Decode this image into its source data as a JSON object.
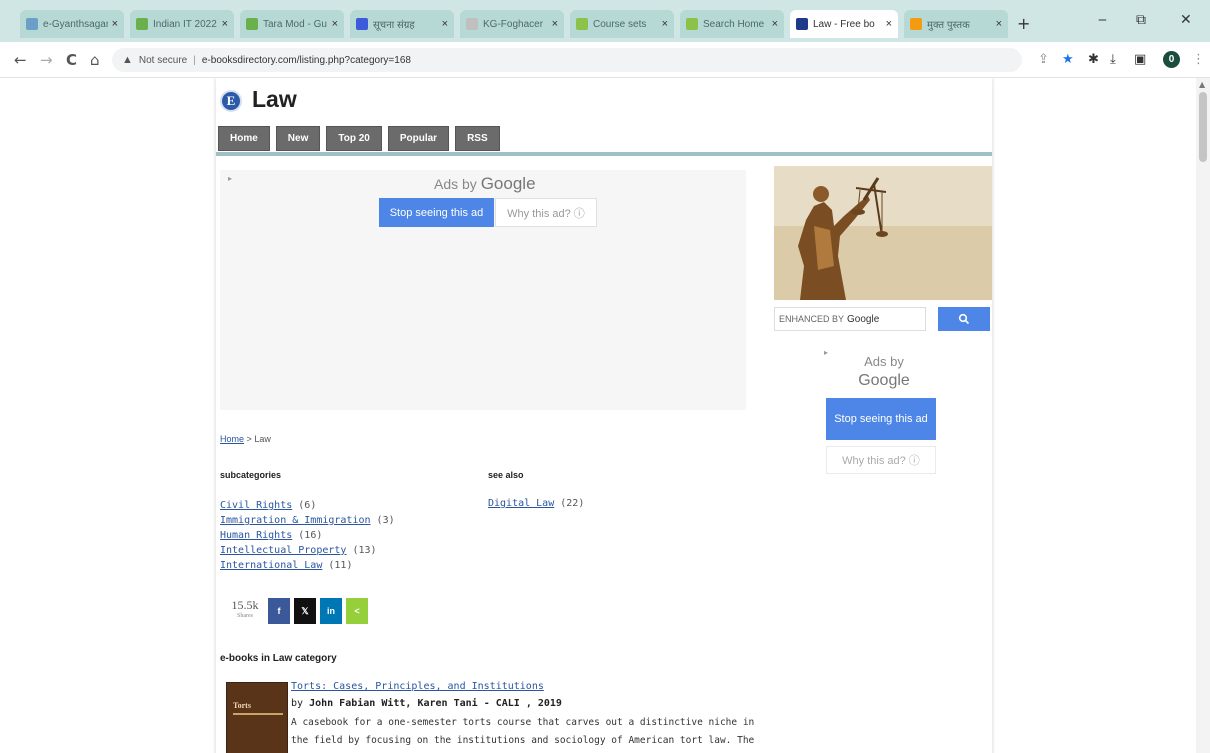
{
  "browser": {
    "tabs": [
      {
        "title": "e-Gyanthsagar",
        "favicon_color": "#6aa0c8"
      },
      {
        "title": "Indian IT 2022",
        "favicon_color": "#6ab04c"
      },
      {
        "title": "Tara Mod - Gu",
        "favicon_color": "#6ab04c"
      },
      {
        "title": "सूचना संग्रह",
        "favicon_color": "#3b5bdb"
      },
      {
        "title": "KG-Foghacer",
        "favicon_color": "#c0c0c0"
      },
      {
        "title": "Course sets",
        "favicon_color": "#8bc34a"
      },
      {
        "title": "Search Home",
        "favicon_color": "#8bc34a"
      },
      {
        "title": "Law - Free bo",
        "favicon_color": "#1e3a8a"
      },
      {
        "title": "मुक्त पुस्तक",
        "favicon_color": "#f39c12"
      }
    ],
    "new_tab": "+",
    "win_min": "‒",
    "win_max": "⧉",
    "win_close": "✕",
    "nav_back": "←",
    "nav_forward": "→",
    "nav_reload": "C",
    "nav_home": "⌂",
    "security_label": "Not secure",
    "url": "e-booksdirectory.com/listing.php?category=168",
    "toolbar_icons": [
      "share-icon",
      "star-icon",
      "extensions-icon",
      "download-icon",
      "sidepanel-icon"
    ],
    "profile_initial": "0",
    "menu_dots": "⋮"
  },
  "site": {
    "logo_letter": "E",
    "title": "Law",
    "nav": [
      "Home",
      "New",
      "Top 20",
      "Popular",
      "RSS"
    ]
  },
  "ad_main": {
    "label_prefix": "Ads by",
    "label_brand": "Google",
    "stop_label": "Stop seeing this ad",
    "why_label": "Why this ad? ⓘ"
  },
  "sidebar": {
    "search_prefix": "ENHANCED BY",
    "search_brand": "Google",
    "ad": {
      "label_prefix": "Ads by",
      "label_brand": "Google",
      "stop_label": "Stop seeing this ad",
      "why_label": "Why this ad? ⓘ"
    }
  },
  "breadcrumb": {
    "home": "Home",
    "sep": ">",
    "current": "Law"
  },
  "subcategories": {
    "heading": "subcategories",
    "items": [
      {
        "label": "Civil Rights",
        "count": "(6)"
      },
      {
        "label": "Immigration & Immigration",
        "count": "(3)"
      },
      {
        "label": "Human Rights",
        "count": "(16)"
      },
      {
        "label": "Intellectual Property",
        "count": "(13)"
      },
      {
        "label": "International Law",
        "count": "(11)"
      }
    ]
  },
  "see_also": {
    "heading": "see also",
    "items": [
      {
        "label": "Digital Law",
        "count": "(22)"
      }
    ]
  },
  "share": {
    "count": "15.5k",
    "count_label": "Shares",
    "buttons": [
      {
        "name": "facebook",
        "glyph": "f",
        "color": "#3b5998"
      },
      {
        "name": "x",
        "glyph": "𝕏",
        "color": "#111111"
      },
      {
        "name": "linkedin",
        "glyph": "in",
        "color": "#0077b5"
      },
      {
        "name": "sharethis",
        "glyph": "<",
        "color": "#95d03a"
      }
    ]
  },
  "ebooks": {
    "heading": "e-books in Law category",
    "book": {
      "cover_title": "Torts",
      "title": "Torts: Cases, Principles, and Institutions",
      "by": "by",
      "authors": "John Fabian Witt, Karen Tani",
      "publisher": "- CALI , 2019",
      "desc": "A casebook for a one-semester torts course that carves out a distinctive niche in the field by focusing on the institutions and sociology of American tort law. The book retains familiar"
    }
  }
}
